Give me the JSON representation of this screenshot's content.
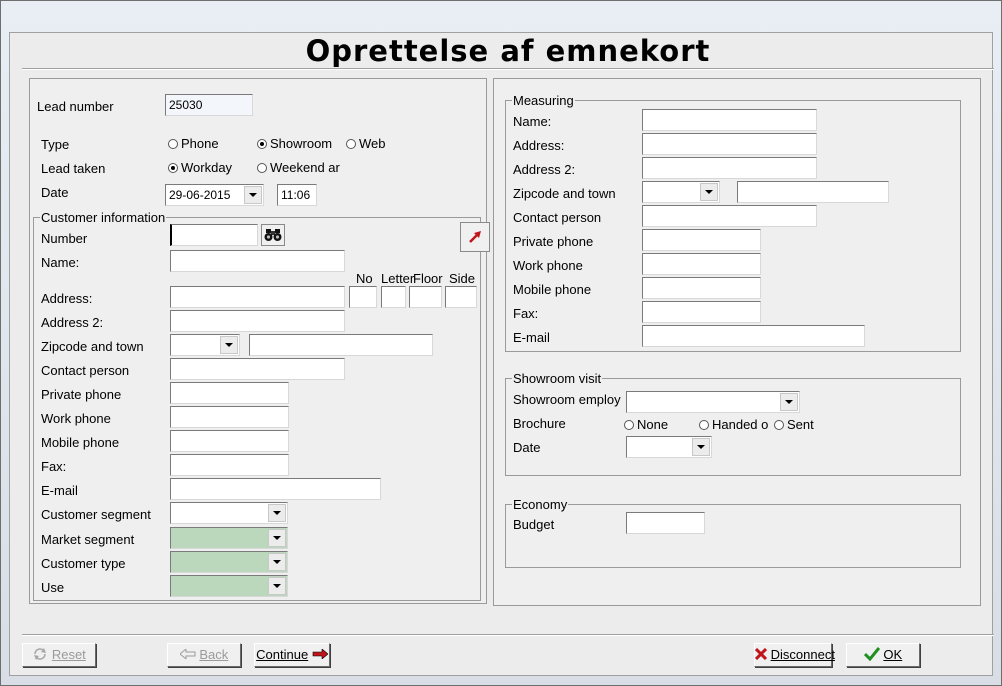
{
  "window": {
    "title": "Oprettelse af emnekort"
  },
  "left": {
    "lead_number": {
      "label": "Lead number",
      "value": "25030"
    },
    "type": {
      "label": "Type",
      "options": [
        "Phone",
        "Showroom",
        "Web"
      ],
      "selected": "Showroom"
    },
    "lead_taken": {
      "label": "Lead taken",
      "options": [
        "Workday",
        "Weekend ar"
      ],
      "selected": "Workday"
    },
    "date": {
      "label": "Date",
      "value": "29-06-2015",
      "time": "11:06"
    },
    "customer": {
      "legend": "Customer information",
      "number_label": "Number",
      "name_label": "Name:",
      "address_label": "Address:",
      "address_cols": [
        "No",
        "Letter",
        "Floor",
        "Side"
      ],
      "address2_label": "Address 2:",
      "zip_label": "Zipcode and town",
      "contact_label": "Contact person",
      "private_phone_label": "Private phone",
      "work_phone_label": "Work phone",
      "mobile_phone_label": "Mobile phone",
      "fax_label": "Fax:",
      "email_label": "E-mail",
      "segment_label": "Customer segment",
      "market_segment_label": "Market segment",
      "customer_type_label": "Customer type",
      "use_label": "Use"
    }
  },
  "right": {
    "measuring": {
      "legend": "Measuring",
      "name_label": "Name:",
      "address_label": "Address:",
      "address2_label": "Address 2:",
      "zip_label": "Zipcode and town",
      "contact_label": "Contact person",
      "private_phone_label": "Private phone",
      "work_phone_label": "Work phone",
      "mobile_phone_label": "Mobile phone",
      "fax_label": "Fax:",
      "email_label": "E-mail"
    },
    "showroom": {
      "legend": "Showroom visit",
      "employee_label": "Showroom employ",
      "brochure_label": "Brochure",
      "brochure_options": [
        "None",
        "Handed o",
        "Sent"
      ],
      "date_label": "Date"
    },
    "economy": {
      "legend": "Economy",
      "budget_label": "Budget"
    }
  },
  "buttons": {
    "reset": "Reset",
    "back": "Back",
    "continue": "Continue",
    "disconnect": "Disconnect",
    "ok": "OK"
  },
  "colors": {
    "green_field": "#bcd8bc",
    "cancel_red": "#c0151b",
    "ok_green": "#1f8f1f"
  }
}
